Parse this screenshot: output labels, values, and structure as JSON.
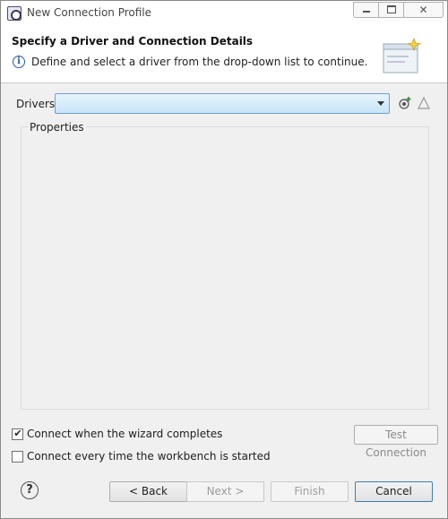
{
  "window": {
    "title": "New Connection Profile",
    "close_glyph": "✕"
  },
  "header": {
    "title": "Specify a Driver and Connection Details",
    "message": "Define and select a driver from the drop-down list to continue.",
    "info_icon": "i"
  },
  "drivers": {
    "label": "Drivers:",
    "value": ""
  },
  "properties": {
    "label": "Properties"
  },
  "options": {
    "connect_on_complete": {
      "label": "Connect when the wizard completes",
      "checked": true
    },
    "connect_on_startup": {
      "label": "Connect every time the workbench is started",
      "checked": false
    }
  },
  "test_connection_label": "Test Connection",
  "buttons": {
    "help": "?",
    "back": "< Back",
    "next": "Next >",
    "finish": "Finish",
    "cancel": "Cancel"
  },
  "icons": {
    "app": "connection-profile-icon",
    "wizard_banner": "wizard-banner-icon",
    "new_driver": "new-driver-icon",
    "edit_driver": "edit-driver-icon"
  },
  "colors": {
    "combo_fill": "#c7e5f9",
    "combo_border": "#6f9fd4",
    "info_blue": "#2a5ba8"
  }
}
